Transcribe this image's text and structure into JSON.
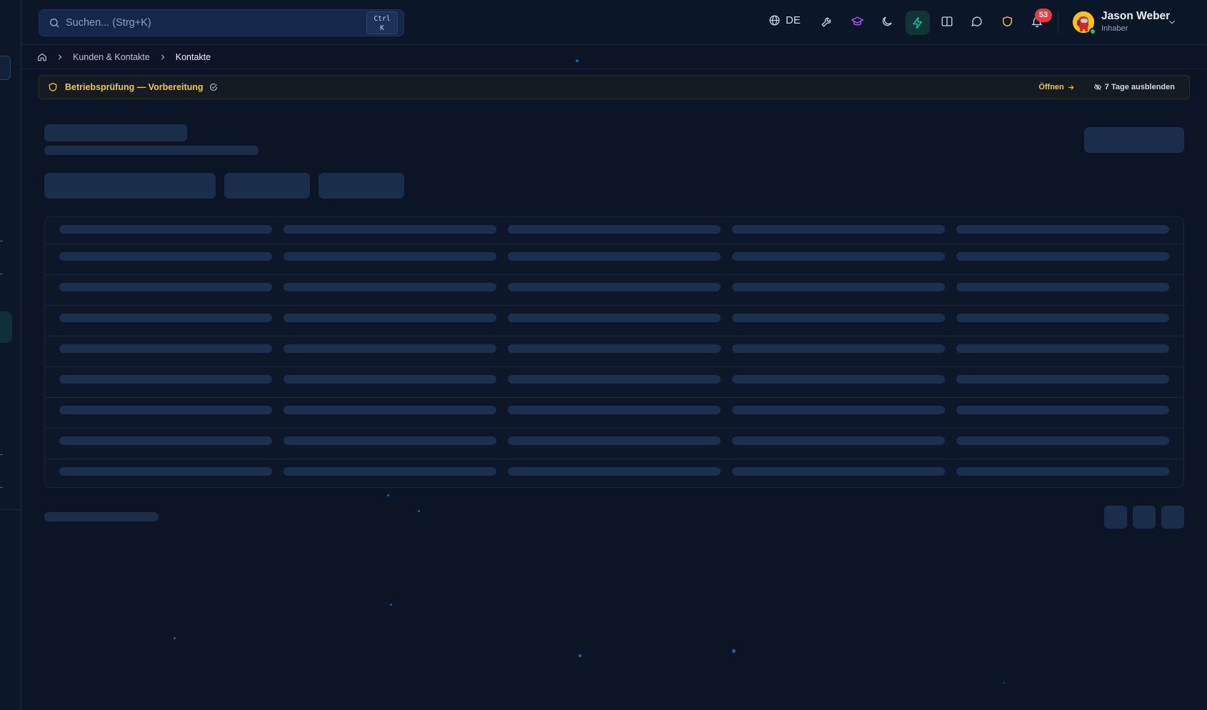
{
  "search": {
    "placeholder": "Suchen... (Strg+K)",
    "shortcut_line1": "Ctrl",
    "shortcut_line2": "K"
  },
  "header": {
    "language": "DE",
    "notifications_count": "53",
    "user": {
      "name": "Jason Weber",
      "role": "Inhaber"
    }
  },
  "breadcrumb": {
    "items": [
      "Kunden & Kontakte",
      "Kontakte"
    ]
  },
  "banner": {
    "title": "Betriebsprüfung — Vorbereitung",
    "open_label": "Öffnen",
    "hide_label": "7 Tage ausblenden"
  },
  "colors": {
    "background": "#0b1525",
    "skeleton": "#1a2d4b",
    "accent_green": "#14b8a6",
    "warning": "#f5c24a",
    "badge": "#e53e3e"
  },
  "table_skeleton": {
    "columns": 5,
    "rows": 9
  }
}
